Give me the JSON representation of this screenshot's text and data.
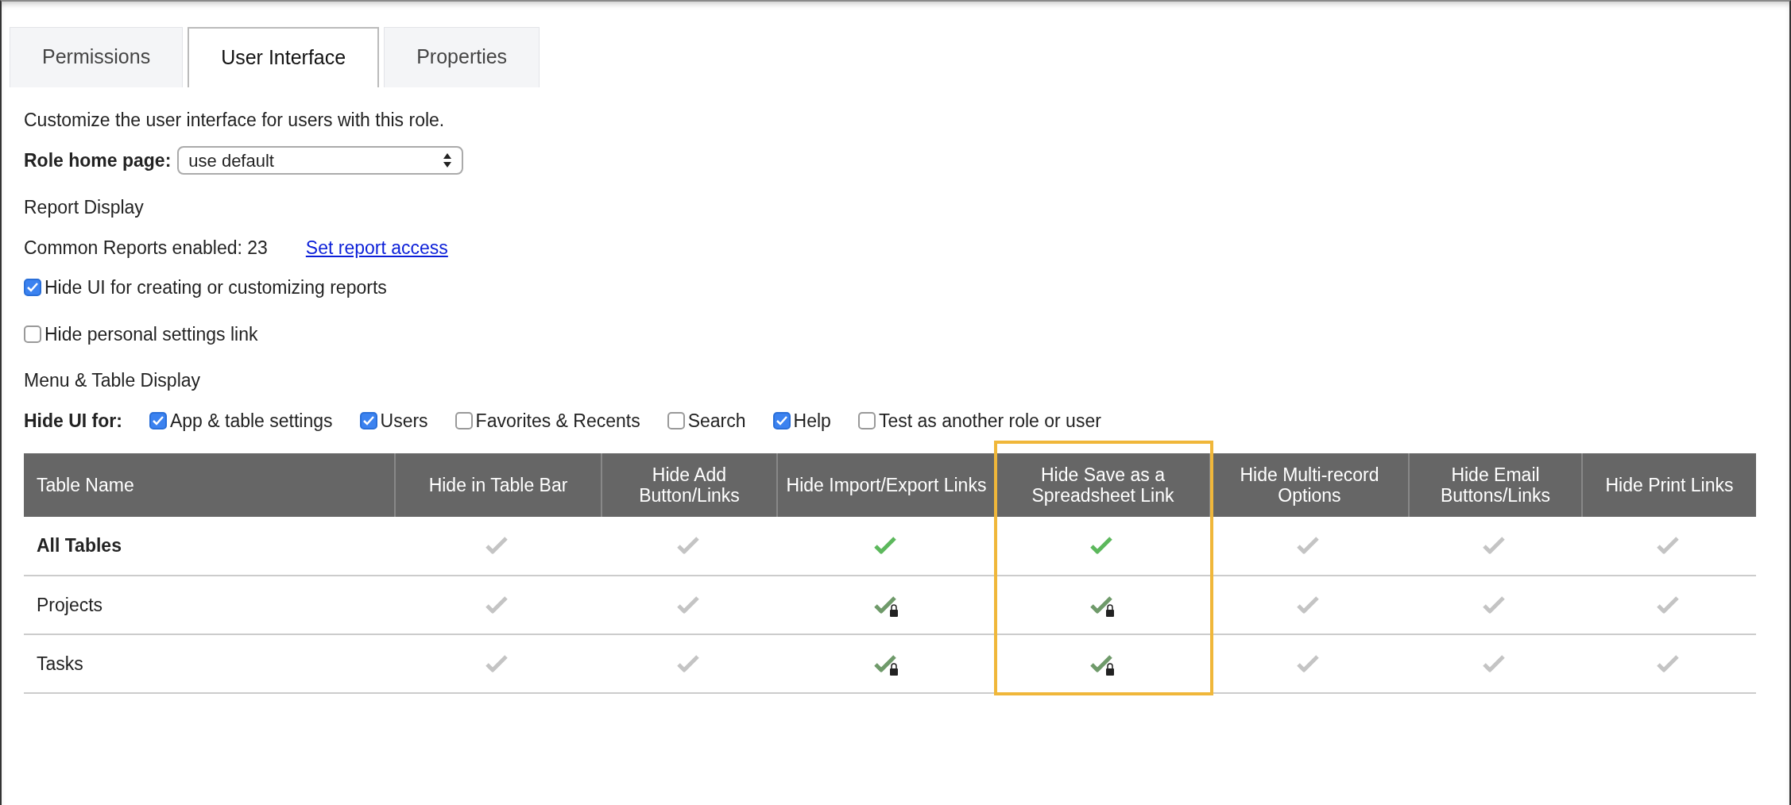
{
  "tabs": [
    {
      "label": "Permissions",
      "selected": false
    },
    {
      "label": "User Interface",
      "selected": true
    },
    {
      "label": "Properties",
      "selected": false
    }
  ],
  "intro": "Customize the user interface for users with this role.",
  "role_home_page": {
    "label": "Role home page:",
    "value": "use default"
  },
  "report_display": {
    "heading": "Report Display",
    "common_reports": "Common Reports enabled: 23",
    "link": "Set report access",
    "options": [
      {
        "label": "Hide UI for creating or customizing reports",
        "checked": true
      },
      {
        "label": "Hide personal settings link",
        "checked": false
      }
    ]
  },
  "menu_table_display": {
    "heading": "Menu & Table Display",
    "hide_ui_label": "Hide UI for:",
    "options": [
      {
        "label": "App & table settings",
        "checked": true
      },
      {
        "label": "Users",
        "checked": true
      },
      {
        "label": "Favorites & Recents",
        "checked": false
      },
      {
        "label": "Search",
        "checked": false
      },
      {
        "label": "Help",
        "checked": true
      },
      {
        "label": "Test as another role or user",
        "checked": false
      }
    ]
  },
  "table": {
    "columns": [
      {
        "label": "Table Name",
        "highlighted": false
      },
      {
        "label": "Hide in Table Bar",
        "highlighted": false
      },
      {
        "label": "Hide Add Button/Links",
        "highlighted": false
      },
      {
        "label": "Hide Import/Export Links",
        "highlighted": false
      },
      {
        "label": "Hide Save as a Spreadsheet Link",
        "highlighted": true
      },
      {
        "label": "Hide Multi-record Options",
        "highlighted": false
      },
      {
        "label": "Hide Email Buttons/Links",
        "highlighted": false
      },
      {
        "label": "Hide Print Links",
        "highlighted": false
      }
    ],
    "rows": [
      {
        "name": "All Tables",
        "bold": true,
        "cells": [
          {
            "checked": false,
            "locked": false
          },
          {
            "checked": false,
            "locked": false
          },
          {
            "checked": true,
            "locked": false
          },
          {
            "checked": true,
            "locked": false
          },
          {
            "checked": false,
            "locked": false
          },
          {
            "checked": false,
            "locked": false
          },
          {
            "checked": false,
            "locked": false
          }
        ]
      },
      {
        "name": "Projects",
        "bold": false,
        "cells": [
          {
            "checked": false,
            "locked": false
          },
          {
            "checked": false,
            "locked": false
          },
          {
            "checked": true,
            "locked": true
          },
          {
            "checked": true,
            "locked": true
          },
          {
            "checked": false,
            "locked": false
          },
          {
            "checked": false,
            "locked": false
          },
          {
            "checked": false,
            "locked": false
          }
        ]
      },
      {
        "name": "Tasks",
        "bold": false,
        "cells": [
          {
            "checked": false,
            "locked": false
          },
          {
            "checked": false,
            "locked": false
          },
          {
            "checked": true,
            "locked": true
          },
          {
            "checked": true,
            "locked": true
          },
          {
            "checked": false,
            "locked": false
          },
          {
            "checked": false,
            "locked": false
          },
          {
            "checked": false,
            "locked": false
          }
        ]
      }
    ]
  }
}
